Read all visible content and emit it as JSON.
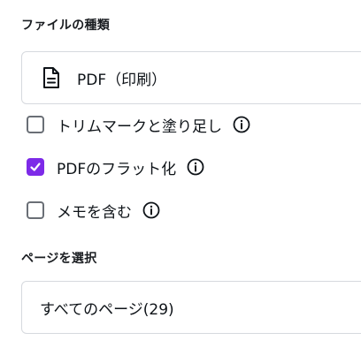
{
  "file_type": {
    "title": "ファイルの種類",
    "selected": "PDF（印刷）",
    "icon": "document-icon"
  },
  "options": [
    {
      "label": "トリムマークと塗り足し",
      "checked": false
    },
    {
      "label": "PDFのフラット化",
      "checked": true
    },
    {
      "label": "メモを含む",
      "checked": false
    }
  ],
  "pages": {
    "title": "ページを選択",
    "selected": "すべてのページ(29)"
  },
  "colors": {
    "accent": "#7d2ae8",
    "border": "#d6d9de",
    "text": "#0e1318"
  }
}
